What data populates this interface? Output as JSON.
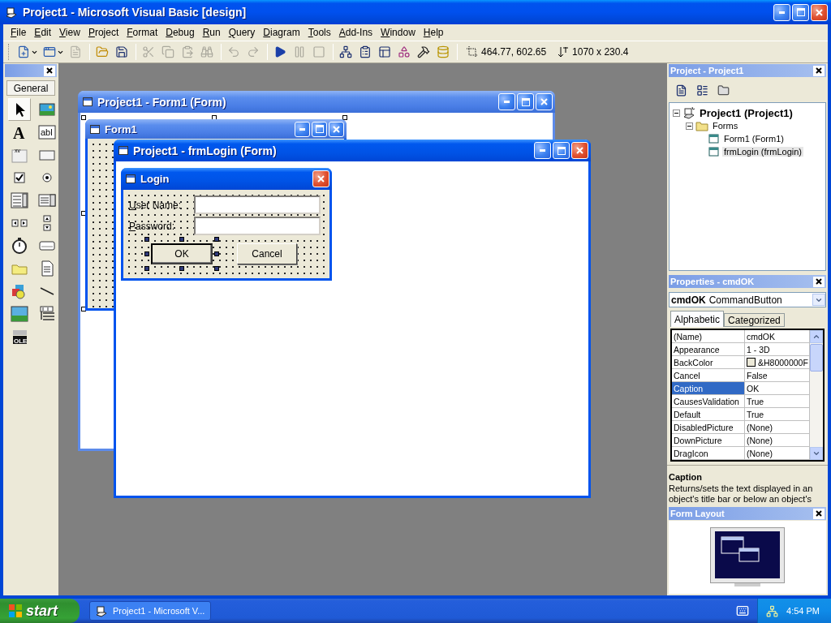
{
  "window": {
    "title": "Project1 - Microsoft Visual Basic [design]"
  },
  "menu": [
    "File",
    "Edit",
    "View",
    "Project",
    "Format",
    "Debug",
    "Run",
    "Query",
    "Diagram",
    "Tools",
    "Add-Ins",
    "Window",
    "Help"
  ],
  "toolbar": {
    "groups": [
      [
        {
          "kind": "add-project",
          "disabled": false
        },
        {
          "kind": "add-form",
          "disabled": false
        },
        {
          "kind": "menu-editor",
          "disabled": true
        }
      ],
      [
        {
          "kind": "open",
          "disabled": false
        },
        {
          "kind": "save",
          "disabled": false
        }
      ],
      [
        {
          "kind": "cut",
          "disabled": true
        },
        {
          "kind": "copy",
          "disabled": true
        },
        {
          "kind": "paste",
          "disabled": true
        },
        {
          "kind": "find",
          "disabled": true
        }
      ],
      [
        {
          "kind": "undo",
          "disabled": true
        },
        {
          "kind": "redo",
          "disabled": true
        }
      ],
      [
        {
          "kind": "start",
          "disabled": false
        },
        {
          "kind": "break",
          "disabled": true
        },
        {
          "kind": "end",
          "disabled": true
        }
      ],
      [
        {
          "kind": "project-explorer",
          "disabled": false
        },
        {
          "kind": "properties-window",
          "disabled": false
        },
        {
          "kind": "form-layout",
          "disabled": false
        },
        {
          "kind": "object-browser",
          "disabled": false
        },
        {
          "kind": "toolbox",
          "disabled": false
        },
        {
          "kind": "data-view",
          "disabled": false
        }
      ]
    ],
    "position": "464.77, 602.65",
    "size": "1070 x 230.4"
  },
  "toolbox": {
    "tab": "General",
    "tools": [
      {
        "kind": "pointer",
        "selected": true
      },
      {
        "kind": "picture",
        "selected": false
      },
      {
        "kind": "label",
        "glyph": "A",
        "selected": false
      },
      {
        "kind": "textbox",
        "glyph": "abl",
        "selected": false
      },
      {
        "kind": "frame",
        "glyph": "xv",
        "selected": false
      },
      {
        "kind": "command-button",
        "selected": false
      },
      {
        "kind": "checkbox",
        "selected": false
      },
      {
        "kind": "option-button",
        "selected": false
      },
      {
        "kind": "combo-box",
        "selected": false
      },
      {
        "kind": "list-box",
        "selected": false
      },
      {
        "kind": "hscroll",
        "selected": false
      },
      {
        "kind": "vscroll",
        "selected": false
      },
      {
        "kind": "timer",
        "selected": false
      },
      {
        "kind": "drive-list",
        "selected": false
      },
      {
        "kind": "dir-list",
        "selected": false
      },
      {
        "kind": "file-list",
        "selected": false
      },
      {
        "kind": "shape",
        "selected": false
      },
      {
        "kind": "line",
        "selected": false
      },
      {
        "kind": "image",
        "selected": false
      },
      {
        "kind": "data",
        "selected": false
      },
      {
        "kind": "ole",
        "glyph": "OLE",
        "selected": false
      }
    ]
  },
  "designers": [
    {
      "title": "Project1 - Form1 (Form)",
      "active": false,
      "form": {
        "kind": "blank",
        "title": "Form1"
      }
    },
    {
      "title": "Project1 - frmLogin (Form)",
      "active": true,
      "form": {
        "kind": "login",
        "title": "Login",
        "fields": [
          {
            "label": "User Name:"
          },
          {
            "label": "Password:"
          }
        ],
        "buttons": [
          {
            "label": "OK",
            "selected": true
          },
          {
            "label": "Cancel",
            "selected": false
          }
        ]
      }
    }
  ],
  "project": {
    "title": "Project - Project1",
    "tree": [
      {
        "label": "Project1 (Project1)",
        "kind": "project",
        "expanded": true,
        "selected": false,
        "children": [
          {
            "label": "Forms",
            "kind": "folder",
            "expanded": true,
            "selected": false,
            "children": [
              {
                "label": "Form1 (Form1)",
                "kind": "form",
                "selected": false
              },
              {
                "label": "frmLogin (frmLogin)",
                "kind": "form",
                "selected": true
              }
            ]
          }
        ]
      }
    ]
  },
  "properties": {
    "title": "Properties - cmdOK",
    "object": "cmdOK",
    "type": "CommandButton",
    "tabs": [
      {
        "label": "Alphabetic",
        "selected": true
      },
      {
        "label": "Categorized",
        "selected": false
      }
    ],
    "rows": [
      {
        "name": "(Name)",
        "value": "cmdOK",
        "kind": "text",
        "selected": false
      },
      {
        "name": "Appearance",
        "value": "1 - 3D",
        "kind": "text",
        "selected": false
      },
      {
        "name": "BackColor",
        "value": "&H8000000F",
        "kind": "color",
        "selected": false
      },
      {
        "name": "Cancel",
        "value": "False",
        "kind": "text",
        "selected": false
      },
      {
        "name": "Caption",
        "value": "OK",
        "kind": "text",
        "selected": true
      },
      {
        "name": "CausesValidation",
        "value": "True",
        "kind": "text",
        "selected": false
      },
      {
        "name": "Default",
        "value": "True",
        "kind": "text",
        "selected": false
      },
      {
        "name": "DisabledPicture",
        "value": "(None)",
        "kind": "text",
        "selected": false
      },
      {
        "name": "DownPicture",
        "value": "(None)",
        "kind": "text",
        "selected": false
      },
      {
        "name": "DragIcon",
        "value": "(None)",
        "kind": "text",
        "selected": false
      }
    ],
    "description": {
      "title": "Caption",
      "text": "Returns/sets the text displayed in an object's title bar or below an object's"
    }
  },
  "form_layout": {
    "title": "Form Layout"
  },
  "taskbar": {
    "start": "start",
    "tasks": [
      {
        "label": "Project1 - Microsoft V...",
        "selected": false
      }
    ],
    "clock": "4:54 PM"
  }
}
